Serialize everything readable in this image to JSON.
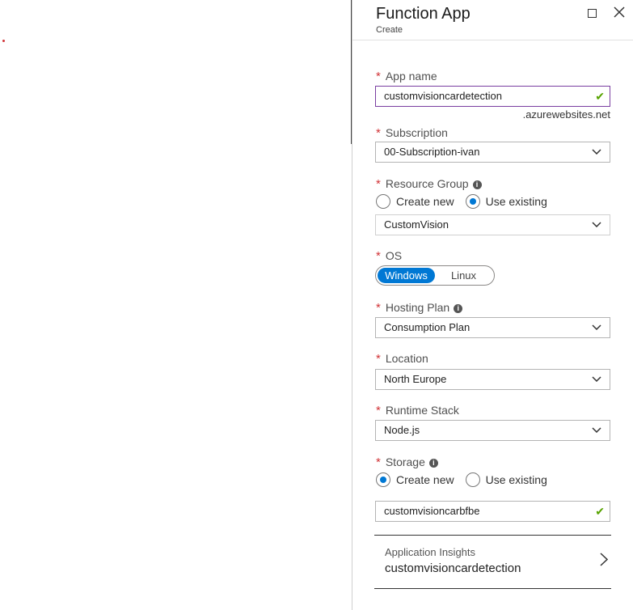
{
  "blade": {
    "title": "Function App",
    "subtitle": "Create"
  },
  "icons": {
    "maximize": "maximize-icon",
    "close": "close-icon",
    "info": "info-icon",
    "check": "check-icon",
    "chevron_down": "chevron-down-icon",
    "chevron_right": "chevron-right-icon"
  },
  "colors": {
    "accent": "#0078d4",
    "required": "#d13438",
    "valid": "#57a300",
    "focus_border": "#7a3ea1"
  },
  "form": {
    "required_mark": "*",
    "app_name": {
      "label": "App name",
      "value": "customvisioncardetection",
      "suffix": ".azurewebsites.net"
    },
    "subscription": {
      "label": "Subscription",
      "value": "00-Subscription-ivan"
    },
    "resource_group": {
      "label": "Resource Group",
      "info": "i",
      "options": [
        "Create new",
        "Use existing"
      ],
      "selected": "Use existing",
      "value": "CustomVision"
    },
    "os": {
      "label": "OS",
      "options": [
        "Windows",
        "Linux"
      ],
      "selected": "Windows"
    },
    "hosting_plan": {
      "label": "Hosting Plan",
      "info": "i",
      "value": "Consumption Plan"
    },
    "location": {
      "label": "Location",
      "value": "North Europe"
    },
    "runtime_stack": {
      "label": "Runtime Stack",
      "value": "Node.js"
    },
    "storage": {
      "label": "Storage",
      "info": "i",
      "options": [
        "Create new",
        "Use existing"
      ],
      "selected": "Create new",
      "value": "customvisioncarbfbe"
    },
    "app_insights": {
      "label": "Application Insights",
      "value": "customvisioncardetection"
    }
  }
}
